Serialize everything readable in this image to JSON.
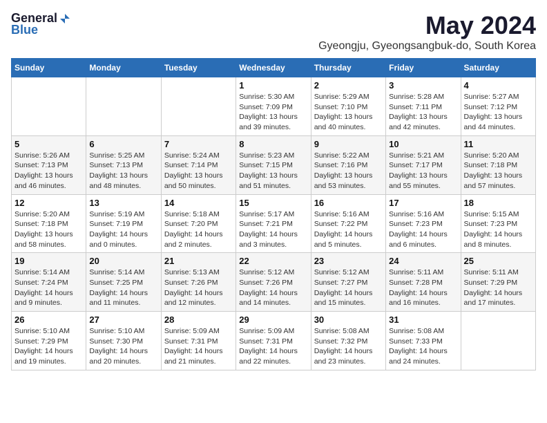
{
  "logo": {
    "general": "General",
    "blue": "Blue"
  },
  "title": {
    "month": "May 2024",
    "location": "Gyeongju, Gyeongsangbuk-do, South Korea"
  },
  "days_header": [
    "Sunday",
    "Monday",
    "Tuesday",
    "Wednesday",
    "Thursday",
    "Friday",
    "Saturday"
  ],
  "weeks": [
    [
      {
        "day": "",
        "info": ""
      },
      {
        "day": "",
        "info": ""
      },
      {
        "day": "",
        "info": ""
      },
      {
        "day": "1",
        "info": "Sunrise: 5:30 AM\nSunset: 7:09 PM\nDaylight: 13 hours\nand 39 minutes."
      },
      {
        "day": "2",
        "info": "Sunrise: 5:29 AM\nSunset: 7:10 PM\nDaylight: 13 hours\nand 40 minutes."
      },
      {
        "day": "3",
        "info": "Sunrise: 5:28 AM\nSunset: 7:11 PM\nDaylight: 13 hours\nand 42 minutes."
      },
      {
        "day": "4",
        "info": "Sunrise: 5:27 AM\nSunset: 7:12 PM\nDaylight: 13 hours\nand 44 minutes."
      }
    ],
    [
      {
        "day": "5",
        "info": "Sunrise: 5:26 AM\nSunset: 7:13 PM\nDaylight: 13 hours\nand 46 minutes."
      },
      {
        "day": "6",
        "info": "Sunrise: 5:25 AM\nSunset: 7:13 PM\nDaylight: 13 hours\nand 48 minutes."
      },
      {
        "day": "7",
        "info": "Sunrise: 5:24 AM\nSunset: 7:14 PM\nDaylight: 13 hours\nand 50 minutes."
      },
      {
        "day": "8",
        "info": "Sunrise: 5:23 AM\nSunset: 7:15 PM\nDaylight: 13 hours\nand 51 minutes."
      },
      {
        "day": "9",
        "info": "Sunrise: 5:22 AM\nSunset: 7:16 PM\nDaylight: 13 hours\nand 53 minutes."
      },
      {
        "day": "10",
        "info": "Sunrise: 5:21 AM\nSunset: 7:17 PM\nDaylight: 13 hours\nand 55 minutes."
      },
      {
        "day": "11",
        "info": "Sunrise: 5:20 AM\nSunset: 7:18 PM\nDaylight: 13 hours\nand 57 minutes."
      }
    ],
    [
      {
        "day": "12",
        "info": "Sunrise: 5:20 AM\nSunset: 7:18 PM\nDaylight: 13 hours\nand 58 minutes."
      },
      {
        "day": "13",
        "info": "Sunrise: 5:19 AM\nSunset: 7:19 PM\nDaylight: 14 hours\nand 0 minutes."
      },
      {
        "day": "14",
        "info": "Sunrise: 5:18 AM\nSunset: 7:20 PM\nDaylight: 14 hours\nand 2 minutes."
      },
      {
        "day": "15",
        "info": "Sunrise: 5:17 AM\nSunset: 7:21 PM\nDaylight: 14 hours\nand 3 minutes."
      },
      {
        "day": "16",
        "info": "Sunrise: 5:16 AM\nSunset: 7:22 PM\nDaylight: 14 hours\nand 5 minutes."
      },
      {
        "day": "17",
        "info": "Sunrise: 5:16 AM\nSunset: 7:23 PM\nDaylight: 14 hours\nand 6 minutes."
      },
      {
        "day": "18",
        "info": "Sunrise: 5:15 AM\nSunset: 7:23 PM\nDaylight: 14 hours\nand 8 minutes."
      }
    ],
    [
      {
        "day": "19",
        "info": "Sunrise: 5:14 AM\nSunset: 7:24 PM\nDaylight: 14 hours\nand 9 minutes."
      },
      {
        "day": "20",
        "info": "Sunrise: 5:14 AM\nSunset: 7:25 PM\nDaylight: 14 hours\nand 11 minutes."
      },
      {
        "day": "21",
        "info": "Sunrise: 5:13 AM\nSunset: 7:26 PM\nDaylight: 14 hours\nand 12 minutes."
      },
      {
        "day": "22",
        "info": "Sunrise: 5:12 AM\nSunset: 7:26 PM\nDaylight: 14 hours\nand 14 minutes."
      },
      {
        "day": "23",
        "info": "Sunrise: 5:12 AM\nSunset: 7:27 PM\nDaylight: 14 hours\nand 15 minutes."
      },
      {
        "day": "24",
        "info": "Sunrise: 5:11 AM\nSunset: 7:28 PM\nDaylight: 14 hours\nand 16 minutes."
      },
      {
        "day": "25",
        "info": "Sunrise: 5:11 AM\nSunset: 7:29 PM\nDaylight: 14 hours\nand 17 minutes."
      }
    ],
    [
      {
        "day": "26",
        "info": "Sunrise: 5:10 AM\nSunset: 7:29 PM\nDaylight: 14 hours\nand 19 minutes."
      },
      {
        "day": "27",
        "info": "Sunrise: 5:10 AM\nSunset: 7:30 PM\nDaylight: 14 hours\nand 20 minutes."
      },
      {
        "day": "28",
        "info": "Sunrise: 5:09 AM\nSunset: 7:31 PM\nDaylight: 14 hours\nand 21 minutes."
      },
      {
        "day": "29",
        "info": "Sunrise: 5:09 AM\nSunset: 7:31 PM\nDaylight: 14 hours\nand 22 minutes."
      },
      {
        "day": "30",
        "info": "Sunrise: 5:08 AM\nSunset: 7:32 PM\nDaylight: 14 hours\nand 23 minutes."
      },
      {
        "day": "31",
        "info": "Sunrise: 5:08 AM\nSunset: 7:33 PM\nDaylight: 14 hours\nand 24 minutes."
      },
      {
        "day": "",
        "info": ""
      }
    ]
  ]
}
